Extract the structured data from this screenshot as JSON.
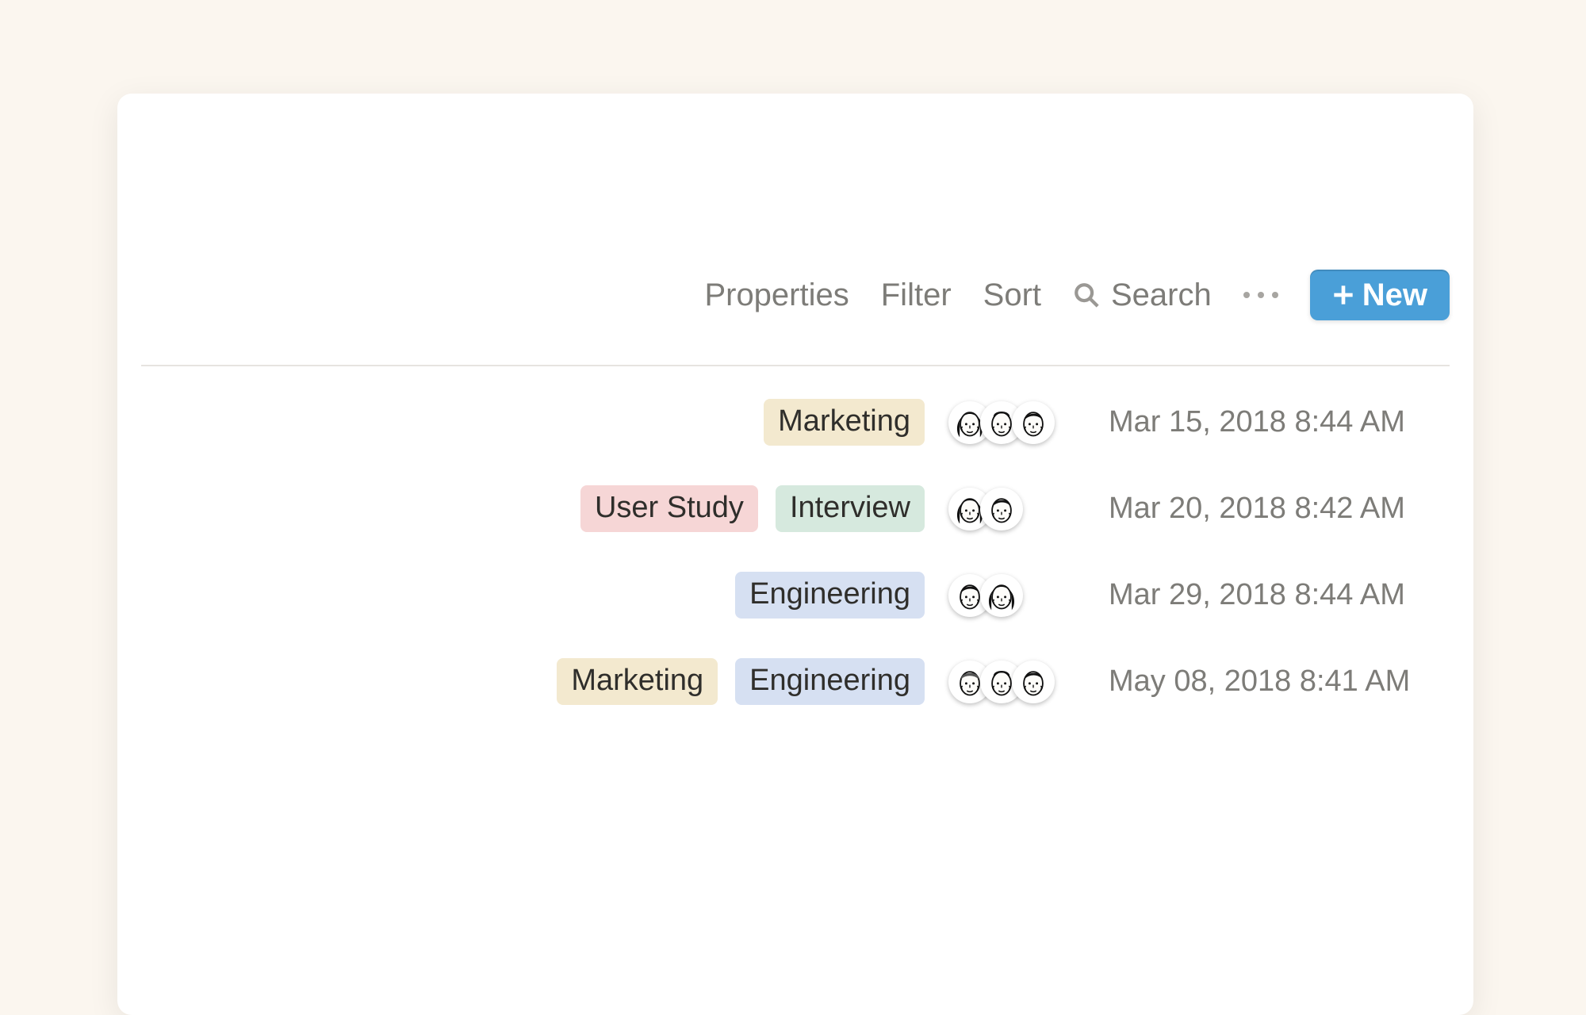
{
  "toolbar": {
    "properties_label": "Properties",
    "filter_label": "Filter",
    "sort_label": "Sort",
    "search_label": "Search",
    "new_label": "New"
  },
  "tag_colors": {
    "Marketing": "#f3e9cf",
    "User Study": "#f6d6d6",
    "Interview": "#d6e9de",
    "Engineering": "#d6e0f2"
  },
  "rows": [
    {
      "tags": [
        "Marketing"
      ],
      "avatars": [
        "f-dark",
        "m-bald",
        "m-short"
      ],
      "date": "Mar 15, 2018 8:44 AM"
    },
    {
      "tags": [
        "User Study",
        "Interview"
      ],
      "avatars": [
        "f-dark",
        "m-short"
      ],
      "date": "Mar 20, 2018 8:42 AM"
    },
    {
      "tags": [
        "Engineering"
      ],
      "avatars": [
        "m-short",
        "f-dark"
      ],
      "date": "Mar 29, 2018 8:44 AM"
    },
    {
      "tags": [
        "Marketing",
        "Engineering"
      ],
      "avatars": [
        "m-light",
        "m-bald",
        "m-short"
      ],
      "date": "May 08, 2018 8:41 AM"
    }
  ]
}
